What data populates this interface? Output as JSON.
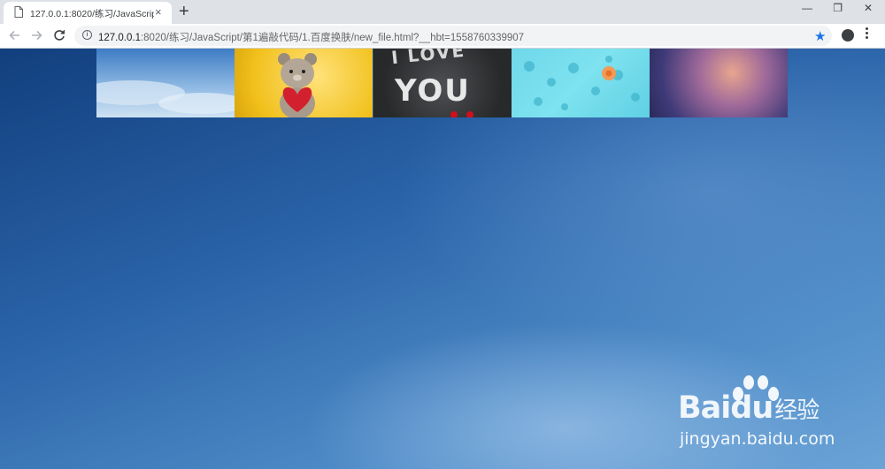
{
  "tab": {
    "title": "127.0.0.1:8020/练习/JavaScript/",
    "close_glyph": "×"
  },
  "new_tab_glyph": "+",
  "window_controls": {
    "minimize": "—",
    "restore": "❐",
    "close": "✕"
  },
  "address_bar": {
    "host": "127.0.0.1",
    "rest": ":8020/练习/JavaScript/第1遍敲代码/1.百度换肤/new_file.html?__hbt=1558760339907"
  },
  "thumbnails": [
    {
      "name": "sky-clouds"
    },
    {
      "name": "bear-with-heart"
    },
    {
      "name": "i-love-you",
      "text_line1": "I LOVE",
      "text_line2": "YOU"
    },
    {
      "name": "water-flower"
    },
    {
      "name": "purple-blur"
    }
  ],
  "watermark": {
    "brand": "Bai",
    "brand_after": "du",
    "brand_cn": "经验",
    "url": "jingyan.baidu.com"
  },
  "colors": {
    "accent": "#1a73e8",
    "page_background": "#2a63a8",
    "tabstrip": "#dee1e6"
  },
  "icons": [
    "page-icon",
    "close-icon",
    "plus-icon",
    "back-arrow-icon",
    "forward-arrow-icon",
    "reload-icon",
    "info-icon",
    "star-icon",
    "account-icon",
    "menu-dots-icon"
  ]
}
